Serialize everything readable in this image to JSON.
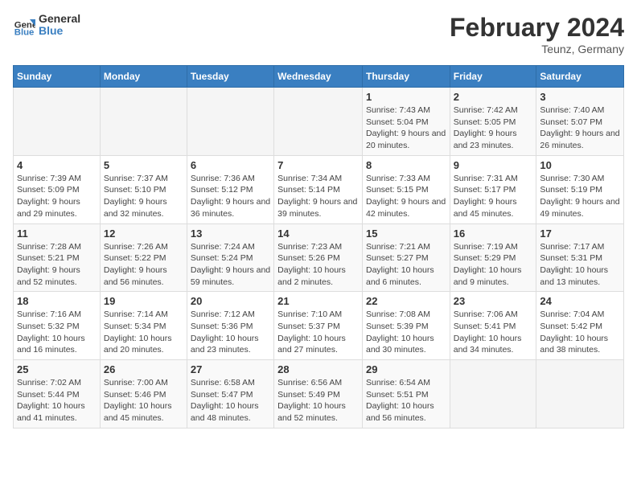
{
  "header": {
    "logo_general": "General",
    "logo_blue": "Blue",
    "month_title": "February 2024",
    "location": "Teunz, Germany"
  },
  "days_of_week": [
    "Sunday",
    "Monday",
    "Tuesday",
    "Wednesday",
    "Thursday",
    "Friday",
    "Saturday"
  ],
  "weeks": [
    [
      {
        "num": "",
        "info": ""
      },
      {
        "num": "",
        "info": ""
      },
      {
        "num": "",
        "info": ""
      },
      {
        "num": "",
        "info": ""
      },
      {
        "num": "1",
        "info": "Sunrise: 7:43 AM\nSunset: 5:04 PM\nDaylight: 9 hours and 20 minutes."
      },
      {
        "num": "2",
        "info": "Sunrise: 7:42 AM\nSunset: 5:05 PM\nDaylight: 9 hours and 23 minutes."
      },
      {
        "num": "3",
        "info": "Sunrise: 7:40 AM\nSunset: 5:07 PM\nDaylight: 9 hours and 26 minutes."
      }
    ],
    [
      {
        "num": "4",
        "info": "Sunrise: 7:39 AM\nSunset: 5:09 PM\nDaylight: 9 hours and 29 minutes."
      },
      {
        "num": "5",
        "info": "Sunrise: 7:37 AM\nSunset: 5:10 PM\nDaylight: 9 hours and 32 minutes."
      },
      {
        "num": "6",
        "info": "Sunrise: 7:36 AM\nSunset: 5:12 PM\nDaylight: 9 hours and 36 minutes."
      },
      {
        "num": "7",
        "info": "Sunrise: 7:34 AM\nSunset: 5:14 PM\nDaylight: 9 hours and 39 minutes."
      },
      {
        "num": "8",
        "info": "Sunrise: 7:33 AM\nSunset: 5:15 PM\nDaylight: 9 hours and 42 minutes."
      },
      {
        "num": "9",
        "info": "Sunrise: 7:31 AM\nSunset: 5:17 PM\nDaylight: 9 hours and 45 minutes."
      },
      {
        "num": "10",
        "info": "Sunrise: 7:30 AM\nSunset: 5:19 PM\nDaylight: 9 hours and 49 minutes."
      }
    ],
    [
      {
        "num": "11",
        "info": "Sunrise: 7:28 AM\nSunset: 5:21 PM\nDaylight: 9 hours and 52 minutes."
      },
      {
        "num": "12",
        "info": "Sunrise: 7:26 AM\nSunset: 5:22 PM\nDaylight: 9 hours and 56 minutes."
      },
      {
        "num": "13",
        "info": "Sunrise: 7:24 AM\nSunset: 5:24 PM\nDaylight: 9 hours and 59 minutes."
      },
      {
        "num": "14",
        "info": "Sunrise: 7:23 AM\nSunset: 5:26 PM\nDaylight: 10 hours and 2 minutes."
      },
      {
        "num": "15",
        "info": "Sunrise: 7:21 AM\nSunset: 5:27 PM\nDaylight: 10 hours and 6 minutes."
      },
      {
        "num": "16",
        "info": "Sunrise: 7:19 AM\nSunset: 5:29 PM\nDaylight: 10 hours and 9 minutes."
      },
      {
        "num": "17",
        "info": "Sunrise: 7:17 AM\nSunset: 5:31 PM\nDaylight: 10 hours and 13 minutes."
      }
    ],
    [
      {
        "num": "18",
        "info": "Sunrise: 7:16 AM\nSunset: 5:32 PM\nDaylight: 10 hours and 16 minutes."
      },
      {
        "num": "19",
        "info": "Sunrise: 7:14 AM\nSunset: 5:34 PM\nDaylight: 10 hours and 20 minutes."
      },
      {
        "num": "20",
        "info": "Sunrise: 7:12 AM\nSunset: 5:36 PM\nDaylight: 10 hours and 23 minutes."
      },
      {
        "num": "21",
        "info": "Sunrise: 7:10 AM\nSunset: 5:37 PM\nDaylight: 10 hours and 27 minutes."
      },
      {
        "num": "22",
        "info": "Sunrise: 7:08 AM\nSunset: 5:39 PM\nDaylight: 10 hours and 30 minutes."
      },
      {
        "num": "23",
        "info": "Sunrise: 7:06 AM\nSunset: 5:41 PM\nDaylight: 10 hours and 34 minutes."
      },
      {
        "num": "24",
        "info": "Sunrise: 7:04 AM\nSunset: 5:42 PM\nDaylight: 10 hours and 38 minutes."
      }
    ],
    [
      {
        "num": "25",
        "info": "Sunrise: 7:02 AM\nSunset: 5:44 PM\nDaylight: 10 hours and 41 minutes."
      },
      {
        "num": "26",
        "info": "Sunrise: 7:00 AM\nSunset: 5:46 PM\nDaylight: 10 hours and 45 minutes."
      },
      {
        "num": "27",
        "info": "Sunrise: 6:58 AM\nSunset: 5:47 PM\nDaylight: 10 hours and 48 minutes."
      },
      {
        "num": "28",
        "info": "Sunrise: 6:56 AM\nSunset: 5:49 PM\nDaylight: 10 hours and 52 minutes."
      },
      {
        "num": "29",
        "info": "Sunrise: 6:54 AM\nSunset: 5:51 PM\nDaylight: 10 hours and 56 minutes."
      },
      {
        "num": "",
        "info": ""
      },
      {
        "num": "",
        "info": ""
      }
    ]
  ]
}
